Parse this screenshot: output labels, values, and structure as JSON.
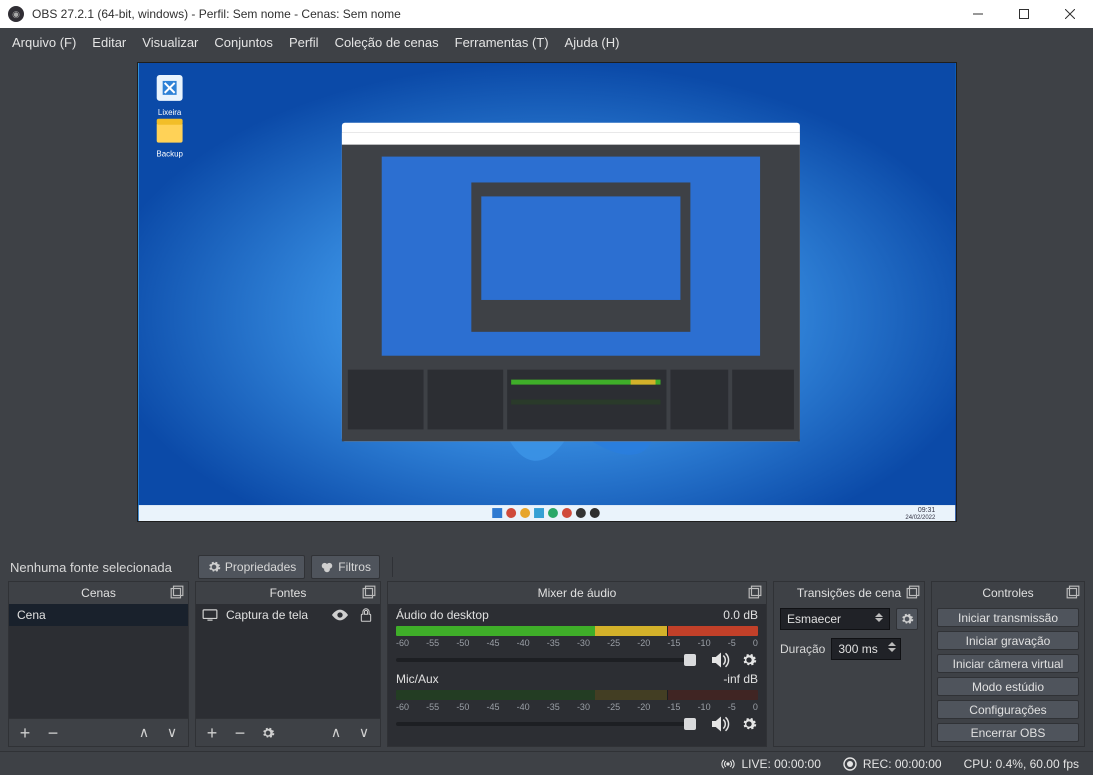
{
  "title": "OBS 27.2.1 (64-bit, windows) - Perfil: Sem nome - Cenas: Sem nome",
  "menubar": [
    "Arquivo (F)",
    "Editar",
    "Visualizar",
    "Conjuntos",
    "Perfil",
    "Coleção de cenas",
    "Ferramentas (T)",
    "Ajuda (H)"
  ],
  "no_source_selected": "Nenhuma fonte selecionada",
  "toolbar": {
    "properties": "Propriedades",
    "filters": "Filtros"
  },
  "docks": {
    "scenes": {
      "title": "Cenas",
      "items": [
        "Cena"
      ]
    },
    "sources": {
      "title": "Fontes",
      "items": [
        {
          "name": "Captura de tela"
        }
      ]
    },
    "mixer": {
      "title": "Mixer de áudio",
      "channels": [
        {
          "name": "Áudio do desktop",
          "level": "0.0 dB"
        },
        {
          "name": "Mic/Aux",
          "level": "-inf dB"
        }
      ],
      "ticks": [
        "-60",
        "-55",
        "-50",
        "-45",
        "-40",
        "-35",
        "-30",
        "-25",
        "-20",
        "-15",
        "-10",
        "-5",
        "0"
      ]
    },
    "transitions": {
      "title": "Transições de cena",
      "selected": "Esmaecer",
      "duration_label": "Duração",
      "duration_value": "300 ms"
    },
    "controls": {
      "title": "Controles",
      "buttons": [
        "Iniciar transmissão",
        "Iniciar gravação",
        "Iniciar câmera virtual",
        "Modo estúdio",
        "Configurações",
        "Encerrar OBS"
      ]
    }
  },
  "statusbar": {
    "live": "LIVE: 00:00:00",
    "rec": "REC: 00:00:00",
    "cpu": "CPU: 0.4%, 60.00 fps"
  }
}
